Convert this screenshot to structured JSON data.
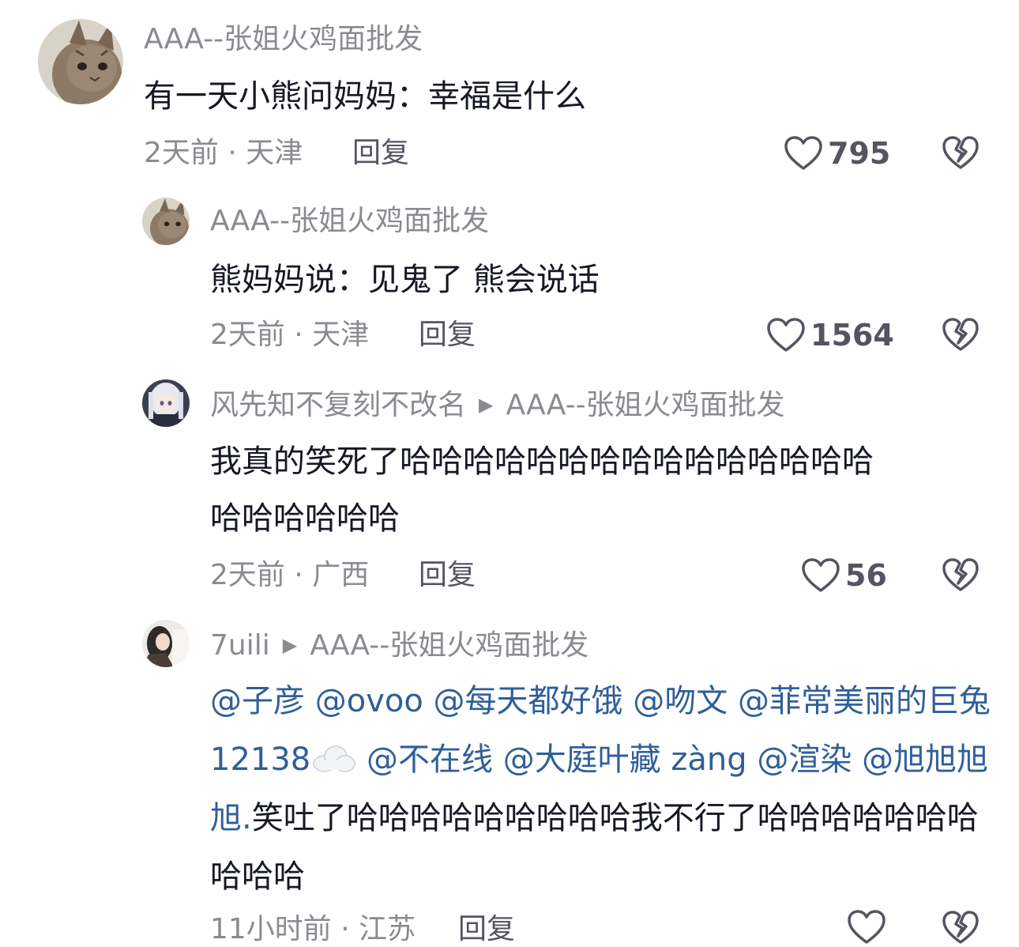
{
  "comments": [
    {
      "username": "AAA--张姐火鸡面批发",
      "text": "有一天小熊问妈妈：幸福是什么",
      "time_location": "2天前 · 天津",
      "reply_label": "回复",
      "likes": "795"
    },
    {
      "username": "AAA--张姐火鸡面批发",
      "text": "熊妈妈说：见鬼了 熊会说话",
      "time_location": "2天前 · 天津",
      "reply_label": "回复",
      "likes": "1564"
    },
    {
      "username": "风先知不复刻不改名",
      "reply_to": "AAA--张姐火鸡面批发",
      "text_line1": "我真的笑死了哈哈哈哈哈哈哈哈哈哈哈哈哈哈哈",
      "text_line2": "哈哈哈哈哈哈",
      "time_location": "2天前 · 广西",
      "reply_label": "回复",
      "likes": "56"
    },
    {
      "username": "7uili",
      "reply_to": "AAA--张姐火鸡面批发",
      "mentions": [
        "@子彦",
        "@ovoo",
        "@每天都好饿",
        "@吻文",
        "@菲常美丽的巨兔12138",
        "@不在线",
        "@大庭叶藏 zàng",
        "@渲染",
        "@旭旭旭旭."
      ],
      "text_after_mentions": "笑吐了哈哈哈哈哈哈哈哈哈我不行了哈哈哈哈哈哈哈哈哈哈",
      "time_location": "11小时前 · 江苏",
      "reply_label": "回复"
    }
  ],
  "icons": [
    "heart-outline-icon",
    "broken-heart-icon",
    "cloud-emoji-icon",
    "play-triangle-icon"
  ],
  "colors": {
    "mention": "#2f5f9a",
    "secondary_text": "#8a8b91",
    "primary_text": "#161823"
  }
}
